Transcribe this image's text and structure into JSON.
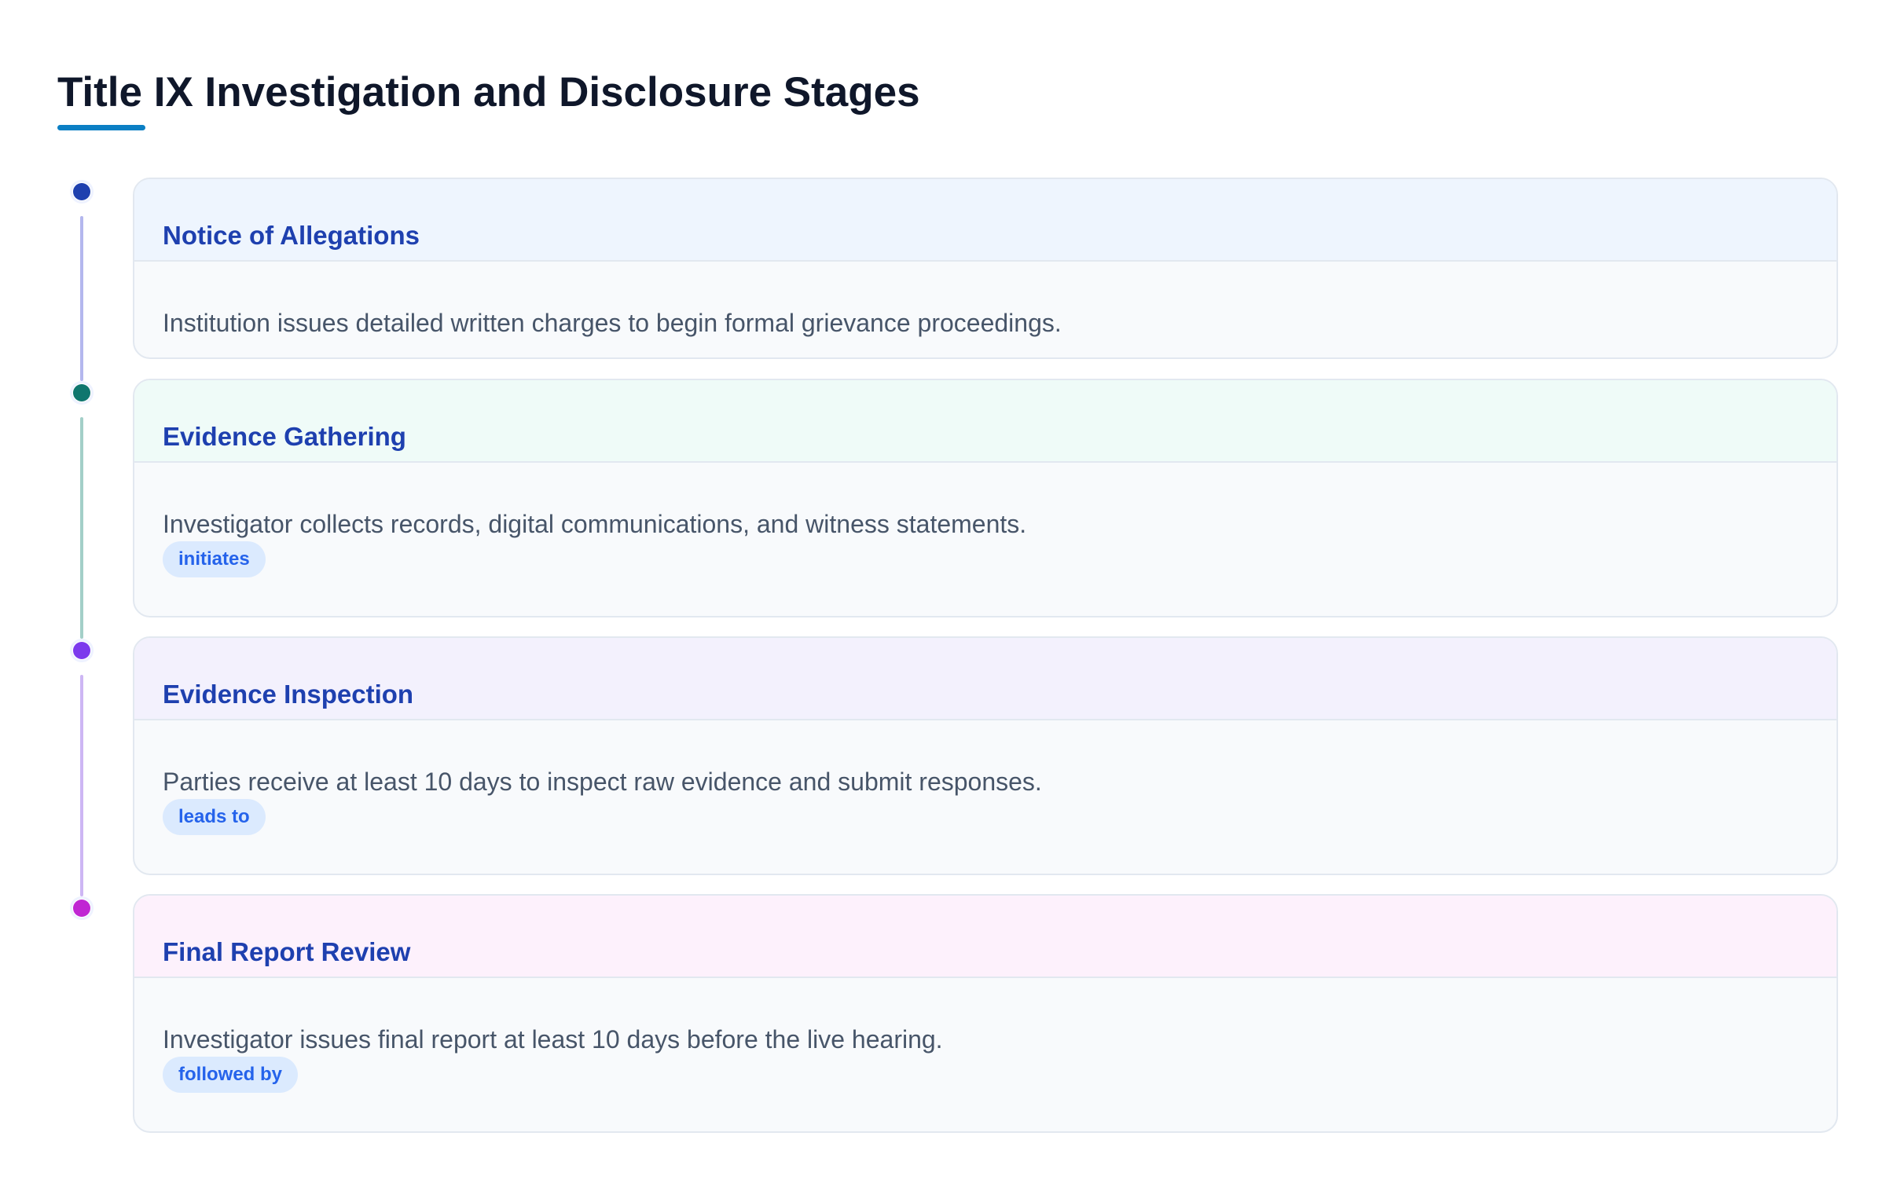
{
  "title": "Title IX Investigation and Disclosure Stages",
  "colors": {
    "accent_underline": "#0b7fc4",
    "title_text": "#0f172a",
    "card_title_text": "#1e40af",
    "desc_text": "#475569",
    "badge_bg": "#dbeafe",
    "badge_text": "#2563eb"
  },
  "stages": [
    {
      "title": "Notice of Allegations",
      "description": "Institution issues detailed written charges to begin formal grievance proceedings.",
      "relation": "",
      "node_color": "#1e40af",
      "header_bg": "#eef5fe",
      "connector_color": "#b4b7ee"
    },
    {
      "title": "Evidence Gathering",
      "description": "Investigator collects records, digital communications, and witness statements.",
      "relation": "initiates",
      "node_color": "#0f766e",
      "header_bg": "#effbf8",
      "connector_color": "#a3cfc8"
    },
    {
      "title": "Evidence Inspection",
      "description": "Parties receive at least 10 days to inspect raw evidence and submit responses.",
      "relation": "leads to",
      "node_color": "#7c3aed",
      "header_bg": "#f3f1fd",
      "connector_color": "#cdb6f4"
    },
    {
      "title": "Final Report Review",
      "description": "Investigator issues final report at least 10 days before the live hearing.",
      "relation": "followed by",
      "node_color": "#c026d3",
      "header_bg": "#fdf1fc",
      "connector_color": ""
    }
  ]
}
